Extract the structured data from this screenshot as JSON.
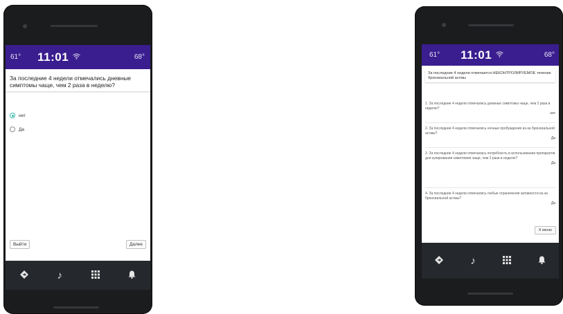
{
  "left": {
    "status": {
      "temp_left": "61°",
      "time": "11:01",
      "wifi_icon": "wifi-icon",
      "temp_right": "68°"
    },
    "question": "За последние 4 недели отмечались дневные симптомы чаще, чем 2 раза в неделю?",
    "options": [
      {
        "label": "нет",
        "checked": true
      },
      {
        "label": "Да",
        "checked": false
      }
    ],
    "buttons": {
      "exit": "Выйти",
      "next": "Далее"
    },
    "nav_icons": [
      "diamond-icon",
      "music-note-icon",
      "grid-icon",
      "bell-icon"
    ]
  },
  "right": {
    "status": {
      "temp_left": "61°",
      "time": "11:01",
      "wifi_icon": "wifi-icon",
      "temp_right": "68°"
    },
    "header": "За последние 4 недели отмечается НЕКОНТРОЛИРУЕМОЕ течение бронхиальной астмы",
    "items": [
      {
        "question": "1. За последние 4 недели отмечались дневные симптомы чаще, чем 2 раза в неделю?",
        "answer": "нет"
      },
      {
        "question": "2. За последние 4 недели отмечались ночные пробуждения из-за бронхиальной астмы?",
        "answer": "Да"
      },
      {
        "question": "3. За последние 4 недели отмечалась потребность в использовании препаратов для купирования симптомов чаще, чем 2 раза в неделю?",
        "answer": "Да"
      },
      {
        "question": "4. За последние 4 недели отмечались любые ограничения активности из-за бронхиальной астмы?",
        "answer": "Да"
      }
    ],
    "button": "К меню",
    "nav_icons": [
      "diamond-icon",
      "music-note-icon",
      "grid-icon",
      "bell-icon"
    ]
  }
}
